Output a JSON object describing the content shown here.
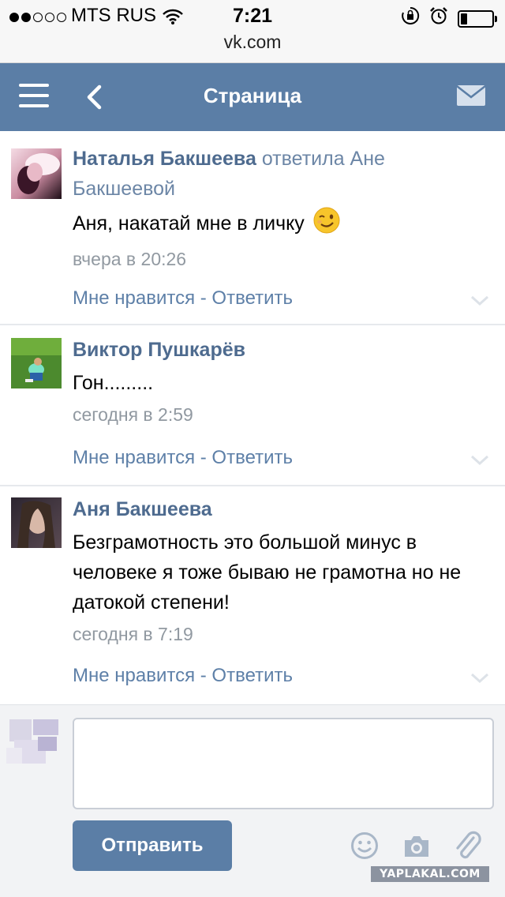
{
  "status_bar": {
    "carrier": "MTS RUS",
    "time": "7:21",
    "url": "vk.com",
    "signal_bars_filled": 2,
    "signal_bars_total": 5,
    "battery_level": 0.2
  },
  "nav": {
    "title": "Страница",
    "menu_icon": "hamburger-icon",
    "back_icon": "chevron-left-icon",
    "mail_icon": "envelope-icon",
    "bar_color": "#5b7ea6"
  },
  "comments": [
    {
      "author": "Наталья Бакшеева",
      "reply_to": "ответила Ане Бакшеевой",
      "text": "Аня, накатай мне в личку",
      "emoji": "winking-face-emoji",
      "time": "вчера в 20:26",
      "like_label": "Мне нравится",
      "separator": " - ",
      "reply_label": "Ответить"
    },
    {
      "author": "Виктор Пушкарёв",
      "reply_to": "",
      "text": "Гон.........",
      "time": "сегодня в 2:59",
      "like_label": "Мне нравится",
      "separator": " - ",
      "reply_label": "Ответить"
    },
    {
      "author": "Аня Бакшеева",
      "reply_to": "",
      "text": "Безграмотность это большой минус в человеке я тоже бываю не грамотна но не датокой степени!",
      "time": "сегодня в 7:19",
      "like_label": "Мне нравится",
      "separator": " - ",
      "reply_label": "Ответить"
    }
  ],
  "composer": {
    "input_value": "",
    "send_label": "Отправить",
    "tools": [
      "smiley-icon",
      "camera-icon",
      "paperclip-icon"
    ]
  },
  "watermark": "YAPLAKAL.COM",
  "colors": {
    "accent": "#5b7ea6",
    "author": "#4e6b8f",
    "link": "#5e80a8",
    "muted": "#9199a1"
  }
}
